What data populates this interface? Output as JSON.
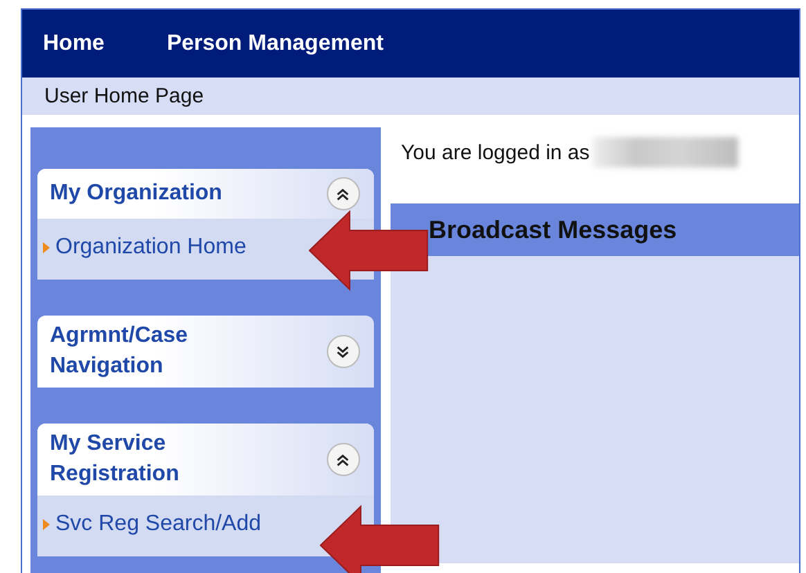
{
  "nav": {
    "items": [
      {
        "label": "Home"
      },
      {
        "label": "Person Management"
      }
    ]
  },
  "breadcrumb": "User Home Page",
  "sidebar": {
    "panels": [
      {
        "title": "My Organization",
        "expanded": true,
        "items": [
          {
            "label": "Organization Home"
          }
        ]
      },
      {
        "title": "Agrmnt/Case Navigation",
        "expanded": false
      },
      {
        "title": "My Service Registration",
        "expanded": true,
        "items": [
          {
            "label": "Svc Reg Search/Add"
          }
        ]
      }
    ]
  },
  "login": {
    "text": "You are logged in as",
    "name_redacted": true
  },
  "broadcast": {
    "title": "Broadcast Messages"
  }
}
